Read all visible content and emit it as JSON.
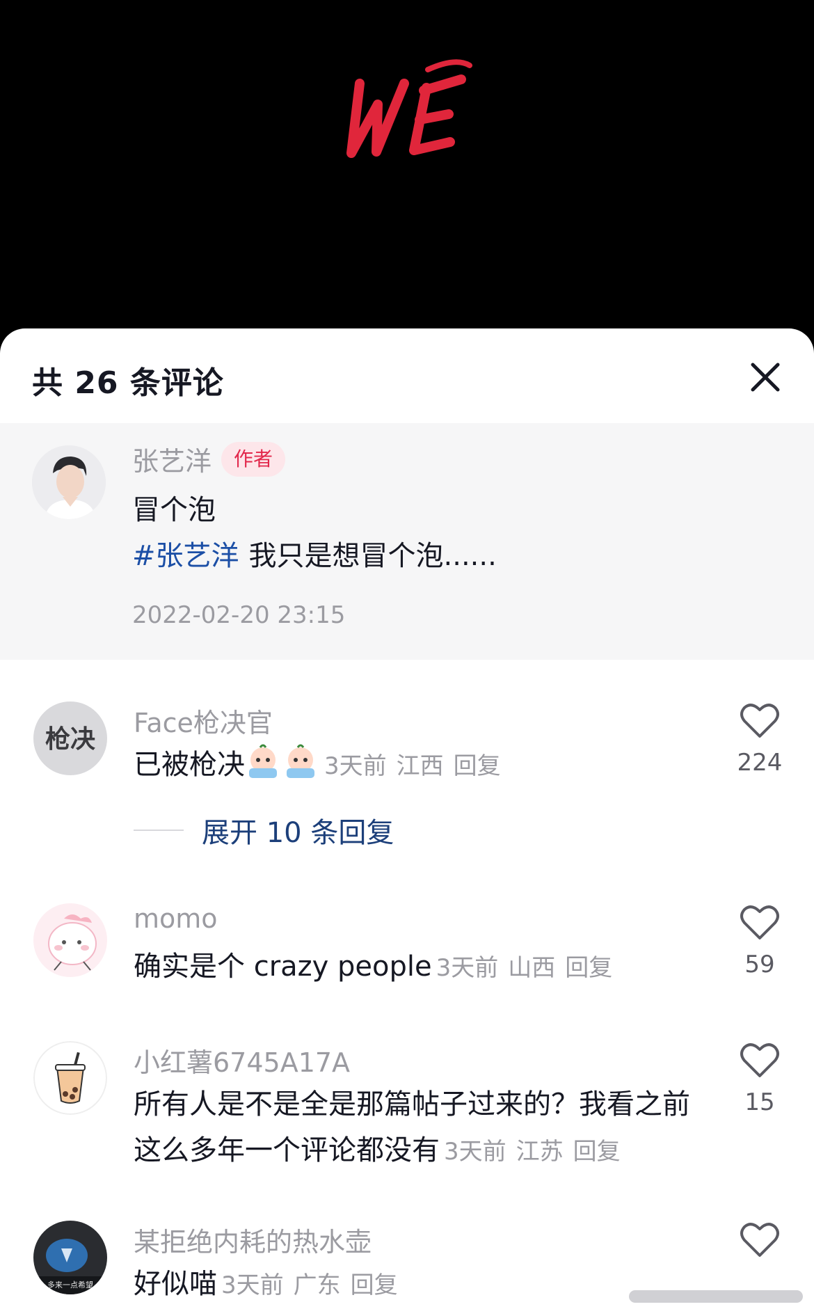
{
  "video": {
    "logo_text": "WE",
    "logo_color": "#e0263b"
  },
  "sheet": {
    "title": "共 26 条评论",
    "close_icon": "close-icon"
  },
  "author_post": {
    "name": "张艺洋",
    "badge": "作者",
    "title": "冒个泡",
    "hashtag": "#张艺洋",
    "desc": "我只是想冒个泡......",
    "time": "2022-02-20 23:15"
  },
  "comments": [
    {
      "name": "Face枪决官",
      "avatar_text": "枪决",
      "text": "已被枪决",
      "emoji": [
        "crying-emoji",
        "crying-emoji"
      ],
      "time": "3天前",
      "location": "江西",
      "reply": "回复",
      "likes": "224",
      "expand": "展开 10 条回复"
    },
    {
      "name": "momo",
      "text": "确实是个 crazy people",
      "time": "3天前",
      "location": "山西",
      "reply": "回复",
      "likes": "59"
    },
    {
      "name": "小红薯6745A17A",
      "text": "所有人是不是全是那篇帖子过来的？我看之前这么多年一个评论都没有",
      "time": "3天前",
      "location": "江苏",
      "reply": "回复",
      "likes": "15"
    },
    {
      "name": "某拒绝内耗的热水壶",
      "avatar_text": "多来一点希望",
      "text": "好似喵",
      "time": "3天前",
      "location": "广东",
      "reply": "回复"
    }
  ],
  "colors": {
    "accent_blue": "#1c4fa6",
    "badge_red": "#e2284c",
    "muted": "#9b9ba1"
  }
}
